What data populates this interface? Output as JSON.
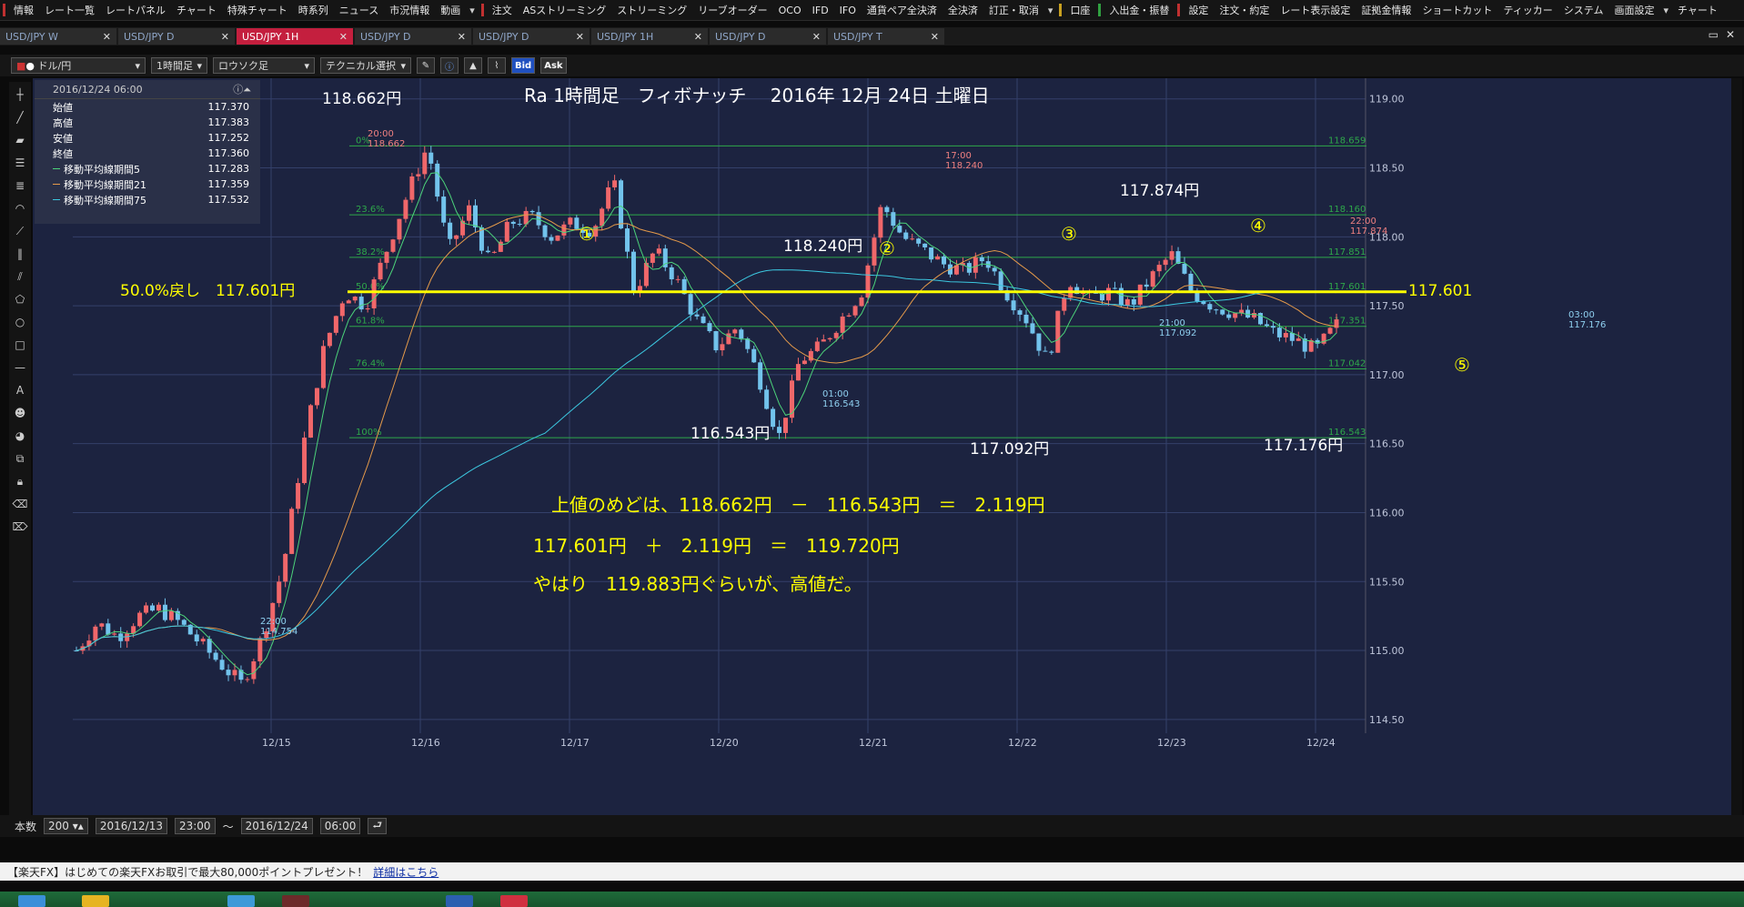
{
  "menubar": {
    "items": [
      "情報",
      "レート一覧",
      "レートパネル",
      "チャート",
      "特殊チャート",
      "時系列",
      "ニュース",
      "市況情報",
      "動画",
      "注文",
      "ASストリーミング",
      "ストリーミング",
      "リーブオーダー",
      "OCO",
      "IFD",
      "IFO",
      "通貨ペア全決済",
      "全決済",
      "訂正・取消",
      "口座",
      "入出金・振替",
      "設定",
      "注文・約定",
      "レート表示設定",
      "証拠金情報",
      "ショートカット",
      "ティッカー",
      "システム",
      "画面設定",
      "チャート"
    ]
  },
  "tabs": [
    {
      "label": "USD/JPY W",
      "active": false
    },
    {
      "label": "USD/JPY D",
      "active": false
    },
    {
      "label": "USD/JPY 1H",
      "active": true
    },
    {
      "label": "USD/JPY D",
      "active": false
    },
    {
      "label": "USD/JPY D",
      "active": false
    },
    {
      "label": "USD/JPY 1H",
      "active": false
    },
    {
      "label": "USD/JPY D",
      "active": false
    },
    {
      "label": "USD/JPY T",
      "active": false
    }
  ],
  "toolbar": {
    "pair": "ドル/円",
    "timeframe": "1時間足",
    "chart_style": "ロウソク足",
    "technical": "テクニカル選択",
    "bid": "Bid",
    "ask": "Ask"
  },
  "infobox": {
    "datetime": "2016/12/24 06:00",
    "rows": [
      {
        "label": "始値",
        "value": "117.370",
        "color": ""
      },
      {
        "label": "高値",
        "value": "117.383",
        "color": ""
      },
      {
        "label": "安値",
        "value": "117.252",
        "color": ""
      },
      {
        "label": "終値",
        "value": "117.360",
        "color": ""
      },
      {
        "label": "移動平均線期間5",
        "value": "117.283",
        "color": "#4cd37a"
      },
      {
        "label": "移動平均線期間21",
        "value": "117.359",
        "color": "#e59a4a"
      },
      {
        "label": "移動平均線期間75",
        "value": "117.532",
        "color": "#3cc8e0"
      }
    ]
  },
  "chart_data": {
    "type": "candlestick",
    "title": "Ra 1時間足　フィボナッチ　 2016年 12月 24日 土曜日",
    "y_ticks": [
      "119.00",
      "118.50",
      "118.00",
      "117.50",
      "117.00",
      "116.50",
      "116.00",
      "115.50",
      "115.00",
      "114.50"
    ],
    "ylim": [
      114.4,
      119.15
    ],
    "x_ticks": [
      "12/15",
      "12/16",
      "12/17",
      "12/20",
      "12/21",
      "12/22",
      "12/23",
      "12/24"
    ],
    "fib_levels": [
      {
        "pct": "0%",
        "value": "118.659"
      },
      {
        "pct": "23.6%",
        "value": "118.160"
      },
      {
        "pct": "38.2%",
        "value": "117.851"
      },
      {
        "pct": "50.0%",
        "value": "117.601"
      },
      {
        "pct": "61.8%",
        "value": "117.351"
      },
      {
        "pct": "76.4%",
        "value": "117.042"
      },
      {
        "pct": "100%",
        "value": "116.543"
      }
    ],
    "halfway_line": {
      "value": 117.601,
      "label_left": "50.0%戻し　117.601円",
      "label_right": "117.601"
    },
    "point_labels": [
      {
        "time": "20:00",
        "price": "118.662",
        "big": "118.662円"
      },
      {
        "time": "17:00",
        "price": "118.240",
        "big": "118.240円"
      },
      {
        "time": "22:00",
        "price": "117.874",
        "big": "117.874円"
      },
      {
        "time": "01:00",
        "price": "116.543",
        "big": "116.543円"
      },
      {
        "time": "21:00",
        "price": "117.092",
        "big": "117.092円"
      },
      {
        "time": "03:00",
        "price": "117.176",
        "big": "117.176円"
      },
      {
        "time": "22:00",
        "price": "114.754",
        "big": ""
      }
    ],
    "wave_marks": [
      "①",
      "②",
      "③",
      "④",
      "⑤"
    ],
    "notes": [
      "上値のめどは、118.662円　－　116.543円　＝　2.119円",
      "117.601円　＋　2.119円　＝　119.720円",
      "やはり　119.883円ぐらいが、高値だ。"
    ],
    "price_path": [
      115.0,
      115.2,
      115.1,
      115.25,
      115.3,
      115.2,
      115.05,
      114.9,
      114.754,
      115.1,
      115.6,
      116.5,
      117.2,
      117.6,
      117.5,
      117.9,
      118.3,
      118.662,
      117.9,
      118.2,
      117.8,
      118.1,
      118.15,
      118.0,
      118.1,
      118.05,
      118.4,
      117.6,
      117.9,
      117.7,
      117.4,
      117.2,
      117.35,
      117.0,
      116.543,
      117.1,
      117.2,
      117.4,
      117.6,
      118.24,
      118.0,
      117.9,
      117.8,
      117.75,
      117.85,
      117.6,
      117.4,
      117.092,
      117.7,
      117.55,
      117.6,
      117.5,
      117.7,
      117.874,
      117.6,
      117.5,
      117.45,
      117.4,
      117.3,
      117.25,
      117.176,
      117.36
    ],
    "candle_count": 200,
    "series": [
      {
        "name": "移動平均線期間5",
        "color": "#4cd37a"
      },
      {
        "name": "移動平均線期間21",
        "color": "#e59a4a"
      },
      {
        "name": "移動平均線期間75",
        "color": "#3cc8e0"
      }
    ]
  },
  "bottombar": {
    "count_label": "本数",
    "count": "200",
    "from_date": "2016/12/13",
    "from_time": "23:00",
    "tilde": "～",
    "to_date": "2016/12/24",
    "to_time": "06:00"
  },
  "adbar": {
    "text": "【楽天FX】はじめての楽天FXお取引で最大80,000ポイントプレゼント！",
    "link": "詳細はこちら"
  },
  "colors": {
    "up": "#f0676a",
    "down": "#72c3ec",
    "grid": "#34406a",
    "fib": "#2ea84a",
    "yellow": "#ffff00"
  }
}
